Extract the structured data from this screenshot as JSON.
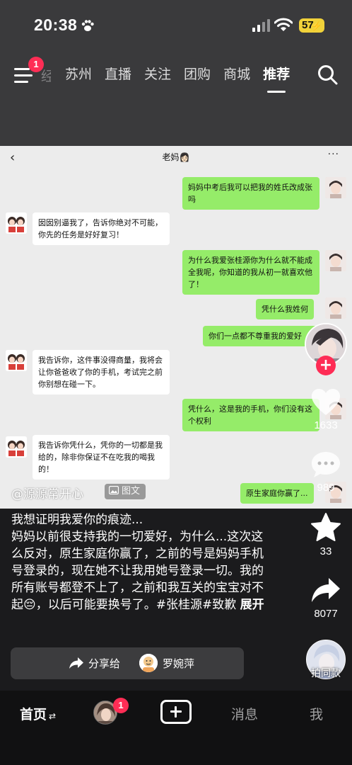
{
  "status_bar": {
    "time": "20:38",
    "battery": "57",
    "icons": [
      "paw-icon",
      "cellular-signal-icon",
      "wifi-icon",
      "battery-charging-icon"
    ]
  },
  "top_nav": {
    "menu_badge": "1",
    "faded_tab": "经",
    "tabs": [
      "苏州",
      "直播",
      "关注",
      "团购",
      "商城",
      "推荐"
    ],
    "active_tab": "推荐"
  },
  "chat": {
    "back_symbol": "‹",
    "title": "老妈👩🏻",
    "more_symbol": "···",
    "messages": [
      {
        "side": "right",
        "text": "妈妈中考后我可以把我的姓氏改成张吗"
      },
      {
        "side": "left",
        "text": "囡囡别逼我了，告诉你绝对不可能，你先的任务是好好复习！"
      },
      {
        "side": "right",
        "text": "为什么我爱张桂源你为什么就不能成全我呢，你知道的我从初一就喜欢他了！"
      },
      {
        "side": "right",
        "text": "凭什么我姓何"
      },
      {
        "side": "right",
        "text": "你们一点都不尊重我的爱好"
      },
      {
        "side": "left",
        "text": "我告诉你，这件事没得商量，我将会让你爸爸收了你的手机，考试完之前你别想在碰一下。"
      },
      {
        "side": "right",
        "text": "凭什么，这是我的手机，你们没有这个权利"
      },
      {
        "side": "left",
        "text": "我告诉你凭什么，凭你的一切都是我给的，除非你保证不在吃我的喝我的！"
      },
      {
        "side": "right",
        "text": "原生家庭你赢了..."
      }
    ]
  },
  "post": {
    "author": "@源源常开心",
    "type_label": "图文",
    "caption": "我想证明我爱你的痕迹...\n妈妈以前很支持我的一切爱好，为什么...这次这么反对，原生家庭你赢了，之前的号是妈妈手机号登录的，现在她不让我用她号登录一切。我的所有账号都登不上了，之前和我互关的宝宝对不起😔，以后可能要换号了。#张桂源#致歉",
    "expand_label": "展开"
  },
  "actions": {
    "likes": "1633",
    "comments": "989",
    "favorites": "33",
    "shares": "8077",
    "follow_symbol": "+"
  },
  "share_bar": {
    "label": "分享给",
    "name": "罗婉萍"
  },
  "shoot_same": {
    "label": "拍同款"
  },
  "tab_bar": {
    "home": "首页",
    "home_suffix": "⇄",
    "friends_badge": "1",
    "messages": "消息",
    "me": "我"
  }
}
